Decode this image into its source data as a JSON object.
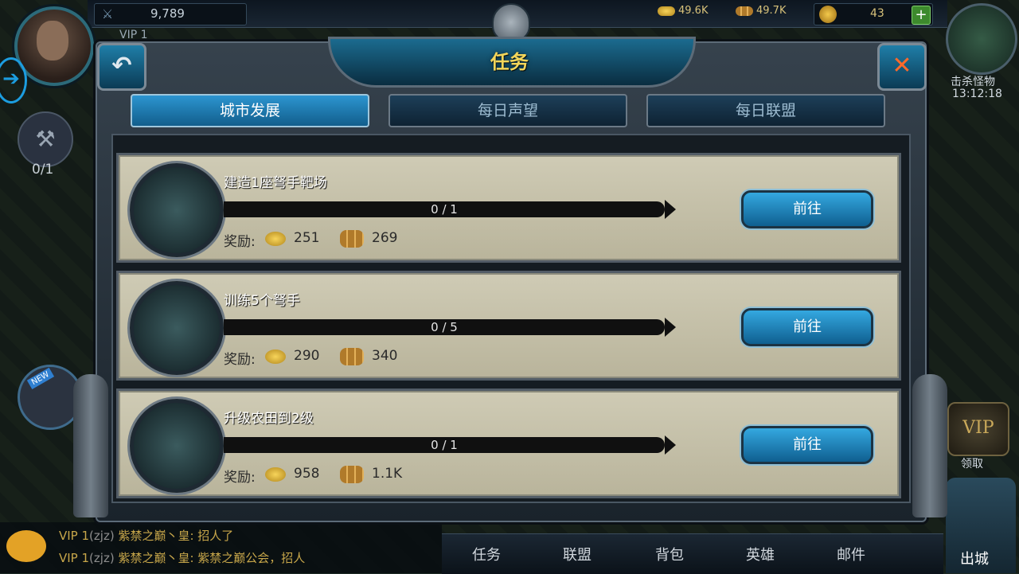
{
  "hud": {
    "power": "9,789",
    "food": "49.6K",
    "wood": "49.7K",
    "gems": "43",
    "plus": "+",
    "vip": "VIP 1"
  },
  "side": {
    "build_count": "0/1",
    "new_badge": "NEW",
    "kill_label": "击杀怪物",
    "kill_time": "13:12:18",
    "vip_label": "领取",
    "out_city": "出城"
  },
  "dialog": {
    "title": "任务",
    "back_icon": "back-arrow-icon",
    "close_icon": "close-x-icon",
    "tabs": [
      {
        "label": "城市发展",
        "active": true
      },
      {
        "label": "每日声望",
        "active": false
      },
      {
        "label": "每日联盟",
        "active": false
      }
    ],
    "quests": [
      {
        "name": "建造1座弩手靶场",
        "progress": "0 / 1",
        "reward_label": "奖励:",
        "food": "251",
        "wood": "269",
        "go_label": "前往"
      },
      {
        "name": "训练5个弩手",
        "progress": "0 / 5",
        "reward_label": "奖励:",
        "food": "290",
        "wood": "340",
        "go_label": "前往"
      },
      {
        "name": "升级农田到2级",
        "progress": "0 / 1",
        "reward_label": "奖励:",
        "food": "958",
        "wood": "1.1K",
        "go_label": "前往"
      }
    ]
  },
  "chat": {
    "lines": [
      {
        "prefix": "VIP 1",
        "tag": "(zjz)",
        "text": "紫禁之巅丶皇: 招人了"
      },
      {
        "prefix": "VIP 1",
        "tag": "(zjz)",
        "text": "紫禁之巅丶皇: 紫禁之巅公会，招人"
      }
    ]
  },
  "bottom_nav": [
    "任务",
    "联盟",
    "背包",
    "英雄",
    "邮件"
  ]
}
